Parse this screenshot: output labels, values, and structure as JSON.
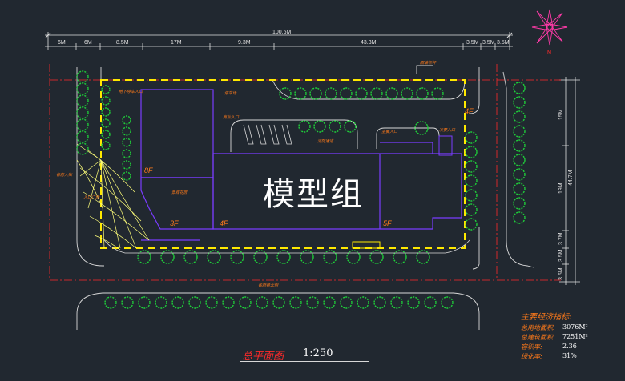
{
  "plan": {
    "watermark": "模型组",
    "title": "总平面图",
    "scale": "1:250",
    "colors": {
      "background": "#212830",
      "dimension": "#e0e0e0",
      "site_boundary": "#ffe900",
      "building": "#7a3cff",
      "road": "#d8d8d8",
      "tree": "#1fcf3a",
      "label": "#ff7a1a",
      "red_line": "#ff2a2a"
    }
  },
  "dimensions": {
    "total_width": "100.6M",
    "top_segments": [
      "6M",
      "6M",
      "8.5M",
      "17M",
      "9.3M",
      "43.3M",
      "3.5M",
      "3.5M",
      "3.5M"
    ],
    "total_height": "44.7M",
    "right_segments": [
      "15M",
      "19M",
      "3.7M",
      "3.5M",
      "3.5M"
    ]
  },
  "floors": [
    "8F",
    "3F",
    "4F",
    "5F",
    "4F"
  ],
  "labels": {
    "road_west": "省府大街",
    "road_south": "省府巷北侧",
    "entry_west": "入口广场",
    "parking_top": "地下停车入口",
    "gate_tr": "围墙栏杆",
    "garden": "景观花园",
    "shop_entry": "商业入口",
    "lane": "消防通道",
    "entry1": "主要入口",
    "entry2": "次要入口",
    "lot_label": "停车场"
  },
  "economic": {
    "title": "主要经济指标:",
    "rows": [
      {
        "label": "总用地面积:",
        "value": "3076M²"
      },
      {
        "label": "总建筑面积:",
        "value": "7251M²"
      },
      {
        "label": "容积率:",
        "value": "2.36"
      },
      {
        "label": "绿化率:",
        "value": "31%"
      }
    ]
  },
  "compass": {
    "north": "N"
  }
}
